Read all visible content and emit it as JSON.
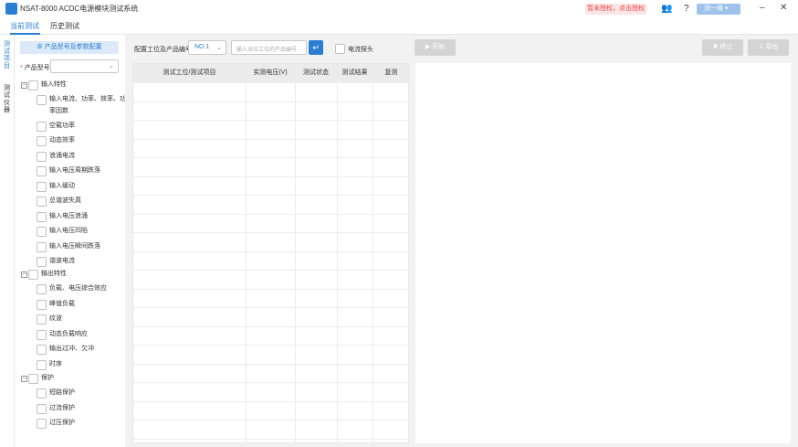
{
  "app": {
    "title": "NSAT-8000 ACDC电源模块测试系统",
    "unauthorized": "暂未授权，点击授权",
    "user_label": "测一维"
  },
  "tabs": [
    {
      "label": "当前测试",
      "active": true
    },
    {
      "label": "历史测试",
      "active": false
    }
  ],
  "left_rail": [
    {
      "label": "测试项目",
      "active": true
    },
    {
      "label": "测试仪器",
      "active": false
    }
  ],
  "panel": {
    "config_button": "产品型号及参数配置",
    "product_model_label": "产品型号",
    "product_model_required": "*",
    "product_model_value": ""
  },
  "tree": {
    "groups": [
      {
        "label": "输入特性",
        "items": [
          "输入电流、功率、效率、功",
          "率因数",
          "空载功率",
          "动态效率",
          "浪涌电流",
          "输入电压周期跌落",
          "输入缓动",
          "总谐波失真",
          "输入电压浪涌",
          "输入电压凹陷",
          "输入电压瞬间跌落",
          "谐波电流"
        ]
      },
      {
        "label": "输出特性",
        "items": [
          "负载、电压综合效应",
          "峰值负载",
          "纹波",
          "动态负载响应",
          "输出过冲、欠冲",
          "时序"
        ]
      },
      {
        "label": "保护",
        "items": [
          "短路保护",
          "过流保护",
          "过压保护"
        ]
      }
    ]
  },
  "toolbar": {
    "config_label": "配置工位及产品编号",
    "station_value": "NO.1",
    "code_placeholder": "输入对应工位的产品编号",
    "probe_label": "电流探头",
    "start_label": "开始",
    "stop_label": "终止",
    "export_label": "导出"
  },
  "table": {
    "headers": [
      "测试工位/测试项目",
      "实测电压(V)",
      "测试状态",
      "测试结果",
      "复测"
    ]
  },
  "colors": {
    "accent": "#2a7fd4",
    "warning": "#e44444",
    "disabled": "#d4d4d4"
  }
}
